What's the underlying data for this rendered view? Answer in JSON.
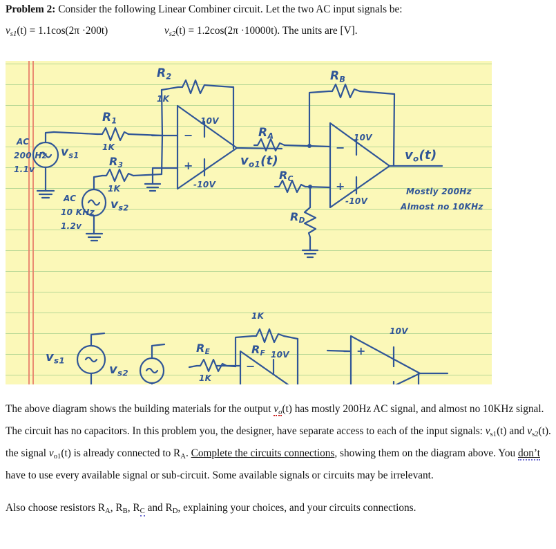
{
  "header": {
    "problem_label": "Problem 2:",
    "intro": "Consider the following Linear Combiner circuit. Let the two AC input signals be:",
    "eq1_lhs": "v",
    "eq1_lhs_sub": "s1",
    "eq1_body": "(t) = 1.1cos(2π ·200t)",
    "eq2_lhs": "v",
    "eq2_lhs_sub": "s2",
    "eq2_body": "(t) = 1.2cos(2π ·10000t)",
    "eq_tail": ". The units are [V]."
  },
  "diagram": {
    "paper_color": "#fbf8b8",
    "rule_color": "#a9d18e",
    "margin_color": "#e8806a",
    "ink_color": "#2f5597",
    "labels": {
      "r1": "R",
      "r1_sub": "1",
      "r1_value": "1K",
      "r2": "R",
      "r2_sub": "2",
      "r2_value": "1K",
      "r3": "R",
      "r3_sub": "3",
      "r3_value": "1K",
      "ra": "R",
      "ra_sub": "A",
      "rb_top": "R",
      "rb_top_sub": "B",
      "rc": "R",
      "rc_sub": "C",
      "rd": "R",
      "rd_sub": "D",
      "re": "R",
      "re_sub": "E",
      "re_value": "1K",
      "rf": "R",
      "rf_sub": "F",
      "rf_value": "1K",
      "src1_ac": "AC",
      "src1_freq": "200 Hz",
      "src1_amp": "1.1v",
      "src1_name": "v",
      "src1_name_sub": "s1",
      "src2_ac": "AC",
      "src2_freq": "10 KHz",
      "src2_amp": "1.2v",
      "src2_name": "v",
      "src2_name_sub": "s2",
      "src3_name": "v",
      "src3_name_sub": "s1",
      "src4_name": "v",
      "src4_name_sub": "s2",
      "vo1": "v",
      "vo1_sub": "o1",
      "vo1_tail": "(t)",
      "vo": "v",
      "vo_sub": "o",
      "vo_tail": "(t)",
      "note_line1": "Mostly 200Hz",
      "note_line2": "Almost no 10KHz",
      "supply_pos": "10V",
      "supply_neg": "-10V",
      "opamp_minus": "−",
      "opamp_plus": "+"
    }
  },
  "body": {
    "para1_a": "The above diagram shows the building materials for the output ",
    "para1_v": "v",
    "para1_v_sub": "o",
    "para1_b": "(t) has mostly 200Hz AC signal, and almost no 10KHz signal.  The circuit has no capacitors. In this problem you, the designer, have separate access to each of the input signals: ",
    "para1_vs1": "v",
    "para1_vs1_sub": "s1",
    "para1_c": "(t) and ",
    "para1_vs2": "v",
    "para1_vs2_sub": "s2",
    "para1_d": "(t). the signal ",
    "para1_vo1": "v",
    "para1_vo1_sub": "o1",
    "para1_e": "(t) is already connected to R",
    "para1_ra_sub": "A",
    "para1_f": ". ",
    "para1_underlined": "Complete the circuits connections",
    "para1_g": ", showing them on the diagram above. You ",
    "para1_dont": "don’t",
    "para1_h": " have to use every available signal or sub-circuit. Some available signals or circuits may be irrelevant.",
    "para2_a": "Also choose resistors R",
    "para2_a_sub": "A",
    "para2_b": ", R",
    "para2_b_sub": "B",
    "para2_c": ", R",
    "para2_c_sub": "C",
    "para2_d": " and R",
    "para2_d_sub": "D",
    "para2_e": ", explaining your choices, and your circuits connections."
  }
}
